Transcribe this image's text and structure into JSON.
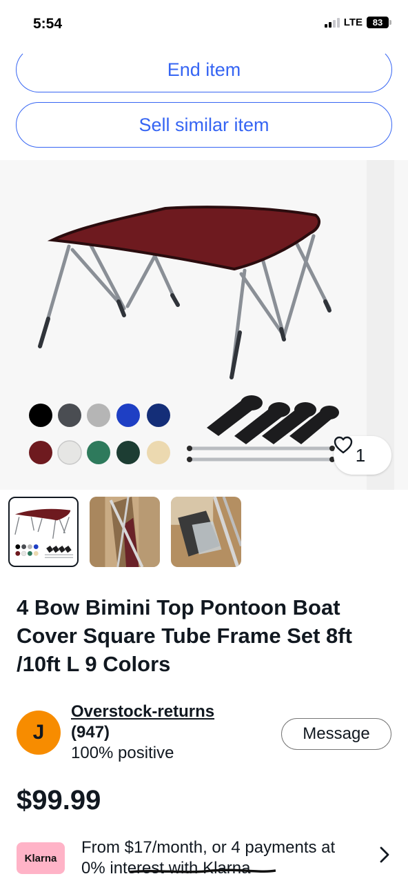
{
  "status_bar": {
    "time": "5:54",
    "network": "LTE",
    "battery": "83"
  },
  "actions": {
    "end_item": "End item",
    "sell_similar": "Sell similar item"
  },
  "hero": {
    "like_count": "1"
  },
  "listing": {
    "title": "4 Bow Bimini Top Pontoon Boat Cover Square Tube Frame Set 8ft /10ft L 9 Colors",
    "price": "$99.99"
  },
  "seller": {
    "initial": "J",
    "name": "Overstock-returns",
    "feedback_count": "(947)",
    "positive": "100% positive",
    "message_label": "Message"
  },
  "financing": {
    "badge": "Klarna",
    "text": "From $17/month, or 4 payments at 0% interest with Klarna"
  },
  "colors": {
    "accent": "#3665f3",
    "canopy": "#6e1a1f",
    "avatar": "#f78c00",
    "klarna": "#ffb3c7",
    "swatches": [
      "#000000",
      "#4a4d52",
      "#b5b5b5",
      "#1e3fc4",
      "#142e78",
      "#6e1a1f",
      "#e6e6e4",
      "#2e7a5c",
      "#1d3d33",
      "#ecd9b0"
    ]
  },
  "icons": {
    "like": "heart-outline-icon",
    "more": "chevron-right-icon"
  }
}
